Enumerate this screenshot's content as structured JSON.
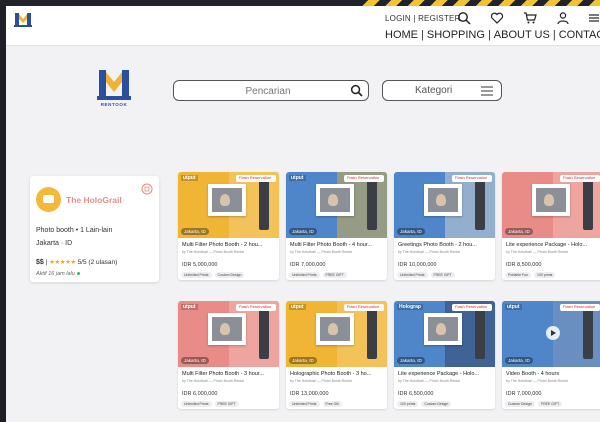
{
  "header": {
    "login_label": "LOGIN",
    "register_label": "REGISTER",
    "separator": "|",
    "icons": [
      "search-icon",
      "heart-icon",
      "cart-icon",
      "user-icon",
      "menu-icon"
    ],
    "nav": [
      {
        "label": "HOME"
      },
      {
        "label": "SHOPPING"
      },
      {
        "label": "ABOUT US"
      },
      {
        "label": "CONTACT US"
      }
    ]
  },
  "brand": {
    "wordmark": "RENTOOK"
  },
  "search": {
    "placeholder": "Pencarian"
  },
  "category_select": {
    "label": "Kategori"
  },
  "vendor": {
    "name": "The HoloGrail",
    "category": "Photo booth • 1 Lain-lain",
    "location": "Jakarta · ID",
    "price_level": "$$",
    "stars": "★★★★★",
    "rating": "5/5",
    "reviews": "(2 ulasan)",
    "active": "Aktif 16 jam lalu"
  },
  "products": [
    {
      "title": "Multi Filter Photo Booth - 2 hou...",
      "by": "by The Hololivari — Photo Booth Rental",
      "price": "IDR 5,000,000",
      "chips": [
        "Unlimited Prints",
        "Custom Design",
        ""
      ],
      "image_tag": "utput",
      "theme": "#f0b534",
      "video": false
    },
    {
      "title": "Multi Filter Photo Booth - 4 hour...",
      "by": "by The Hololivari — Photo Booth Rental",
      "price": "IDR 7,000,000",
      "chips": [
        "Unlimited Prints",
        "FREE GIFT",
        ""
      ],
      "image_tag": "utput",
      "theme": "#4e86c9",
      "video": false
    },
    {
      "title": "Greetings Photo Booth - 2 hou...",
      "by": "by The Hololivari — Photo Booth Rental",
      "price": "IDR 10,000,000",
      "chips": [
        "Unlimited Prints",
        "FREE GIFT",
        ""
      ],
      "image_tag": "",
      "theme": "#4e86c9",
      "video": false
    },
    {
      "title": "Lite experience Package - Holo...",
      "by": "by The Hololivari — Photo Booth Rental",
      "price": "IDR 8,500,000",
      "chips": [
        "Portable Fun",
        "100 prints",
        ""
      ],
      "image_tag": "",
      "theme": "#e98b86",
      "video": false
    },
    {
      "title": "Multi Filter Photo Booth - 3 hour...",
      "by": "by The Hololivari — Photo Booth Rental",
      "price": "IDR 6,000,000",
      "chips": [
        "Unlimited Prints",
        "FREE GIFT",
        ""
      ],
      "image_tag": "utput",
      "theme": "#e98b86",
      "video": false
    },
    {
      "title": "Holographic Photo Booth - 3 ho...",
      "by": "by The Hololivari — Photo Booth Rental",
      "price": "IDR 13,000,000",
      "chips": [
        "Unlimited Prints",
        "Free GB",
        ""
      ],
      "image_tag": "utput",
      "theme": "#f0b534",
      "video": false
    },
    {
      "title": "Lite experience Package - Holo...",
      "by": "by The Hololivari — Photo Booth Rental",
      "price": "IDR 6,500,000",
      "chips": [
        "100 prints",
        "Custom Design",
        ""
      ],
      "image_tag": "Holograp",
      "theme": "#4e86c9",
      "video": false
    },
    {
      "title": "Video Booth - 4 hours",
      "by": "by The Hololivari — Photo Booth Rental",
      "price": "IDR 7,000,000",
      "chips": [
        "Custom Design",
        "FREE GIFT",
        ""
      ],
      "image_tag": "utput",
      "theme": "#4e86c9",
      "video": true
    }
  ],
  "product_badge": "Flash Reservation",
  "product_location": "Jakarta, ID",
  "colors": {
    "accent_yellow": "#f0b534",
    "accent_blue": "#4e86c9",
    "accent_pink": "#e98b86",
    "vendor_name": "#e88c8c",
    "star": "#f5a623"
  }
}
